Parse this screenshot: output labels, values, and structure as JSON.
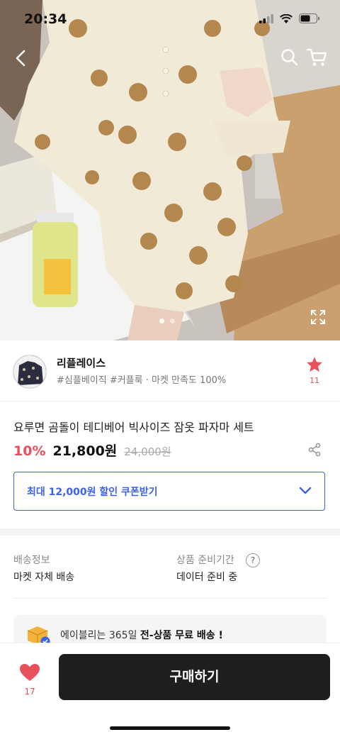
{
  "status_bar": {
    "time": "20:34"
  },
  "hero": {
    "image_label": "product-photo",
    "slide_count": 2,
    "active_slide": 1
  },
  "seller": {
    "name": "리플레이스",
    "tags": "#심플베이직 #커플룩 · 마켓 만족도 100%",
    "favorite_count": "11"
  },
  "product": {
    "title": "요루면 곰돌이 테디베어 빅사이즈 잠옷 파자마 세트",
    "discount": "10%",
    "price": "21,800원",
    "original_price": "24,000원"
  },
  "coupon": {
    "label": "최대 12,000원 할인 쿠폰받기"
  },
  "shipping": {
    "info_label": "배송정보",
    "info_value": "마켓 자체 배송",
    "prep_label": "상품 준비기간",
    "prep_value": "데이터 준비 중",
    "help_glyph": "?"
  },
  "banner": {
    "prefix": "에이블리는 365일 ",
    "highlight": "전-상품 무료 배송 !"
  },
  "bottom_bar": {
    "like_count": "17",
    "buy_label": "구매하기"
  },
  "colors": {
    "accent_red": "#e8505b",
    "accent_blue": "#3b62e8",
    "buy_button": "#1e1e1e"
  },
  "icons": [
    "back-icon",
    "search-icon",
    "cart-icon",
    "expand-icon",
    "star-icon",
    "share-icon",
    "chevron-down-icon",
    "help-icon",
    "delivery-box-icon",
    "heart-icon"
  ]
}
